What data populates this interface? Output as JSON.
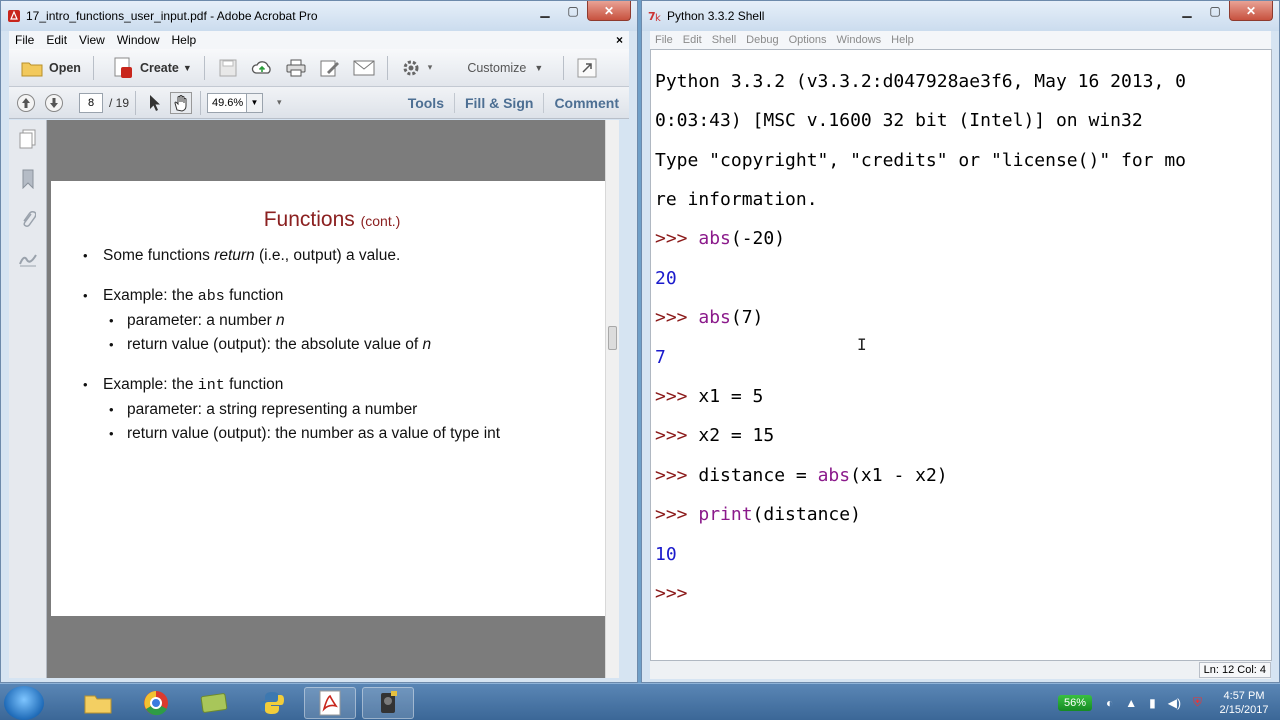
{
  "acrobat": {
    "title": "17_intro_functions_user_input.pdf - Adobe Acrobat Pro",
    "menu": [
      "File",
      "Edit",
      "View",
      "Window",
      "Help"
    ],
    "menu_close": "×",
    "toolbar": {
      "open_label": "Open",
      "create_label": "Create",
      "customize_label": "Customize"
    },
    "nav": {
      "page_current": "8",
      "page_total": "/ 19",
      "zoom": "49.6%"
    },
    "panels": [
      "Tools",
      "Fill & Sign",
      "Comment"
    ],
    "slide": {
      "title": "Functions",
      "title_suffix": "(cont.)",
      "b1_pre": "Some functions ",
      "b1_em": "return",
      "b1_post": " (i.e., output) a value.",
      "b2_pre": "Example: the ",
      "b2_code": "abs",
      "b2_post": " function",
      "b2_sub1_pre": "parameter: a number ",
      "b2_sub1_em": "n",
      "b2_sub2_pre": "return value (output): the absolute value of ",
      "b2_sub2_em": "n",
      "b3_pre": "Example: the ",
      "b3_code": "int",
      "b3_post": " function",
      "b3_sub1": "parameter: a string representing a number",
      "b3_sub2": "return value (output): the number as a value of type int"
    }
  },
  "shell": {
    "title": "Python 3.3.2 Shell",
    "menu": [
      "File",
      "Edit",
      "Shell",
      "Debug",
      "Options",
      "Windows",
      "Help"
    ],
    "banner": [
      "Python 3.3.2 (v3.3.2:d047928ae3f6, May 16 2013, 0",
      "0:03:43) [MSC v.1600 32 bit (Intel)] on win32",
      "Type \"copyright\", \"credits\" or \"license()\" for mo",
      "re information."
    ],
    "prompt": ">>>",
    "l1_fn": "abs",
    "l1_rest": "(-20)",
    "r1": "20",
    "l2_fn": "abs",
    "l2_rest": "(7)",
    "r2": "7",
    "l3": "x1 = 5",
    "l4": "x2 = 15",
    "l5_pre": "distance = ",
    "l5_fn": "abs",
    "l5_rest": "(x1 - x2)",
    "l6_fn": "print",
    "l6_rest": "(distance)",
    "r3": "10",
    "status": "Ln: 12  Col: 4"
  },
  "taskbar": {
    "battery": "56%",
    "time": "4:57 PM",
    "date": "2/15/2017"
  }
}
